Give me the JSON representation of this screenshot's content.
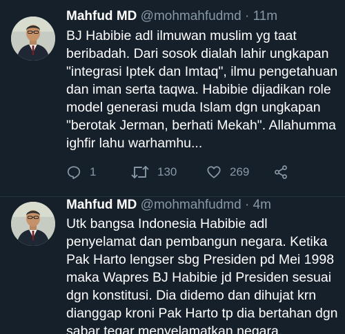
{
  "tweets": [
    {
      "author_name": "Mahfud MD",
      "handle": "@mohmahfudmd",
      "separator": "·",
      "time": "11m",
      "text": "BJ Habibie adl ilmuwan muslim yg taat\nberibadah. Dari sosok dialah lahir ungkapan\n\"integrasi Iptek dan Imtaq\", ilmu pengetahuan\ndan iman serta taqwa. Habibie dijadikan role\nmodel generasi muda Islam dgn ungkapan\n\"berotak Jerman, berhati Mekah\". Allahumma\nighfir lahu warhamhu...",
      "reply_count": "1",
      "retweet_count": "130",
      "like_count": "269"
    },
    {
      "author_name": "Mahfud MD",
      "handle": "@mohmahfudmd",
      "separator": "·",
      "time": "4m",
      "text": "Utk bangsa Indonesia Habibie adl\npenyelamat dan pembangun negara. Ketika\nPak Harto lengser sbg Presiden pd Mei 1998\nmaka Wapres BJ Habibie jd Presiden sesuai\ndgn konstitusi. Dia didemo dan dihujat krn\ndianggap kroni Pak Harto tp dia bertahan dgn\nsabar tegar menyelamatkan negara."
    }
  ],
  "icons": {
    "reply": "reply-icon",
    "retweet": "retweet-icon",
    "like": "heart-icon",
    "share": "share-icon"
  },
  "colors": {
    "background": "#15202b",
    "text_primary": "#ffffff",
    "text_secondary": "#8899a6",
    "divider": "#253341"
  }
}
